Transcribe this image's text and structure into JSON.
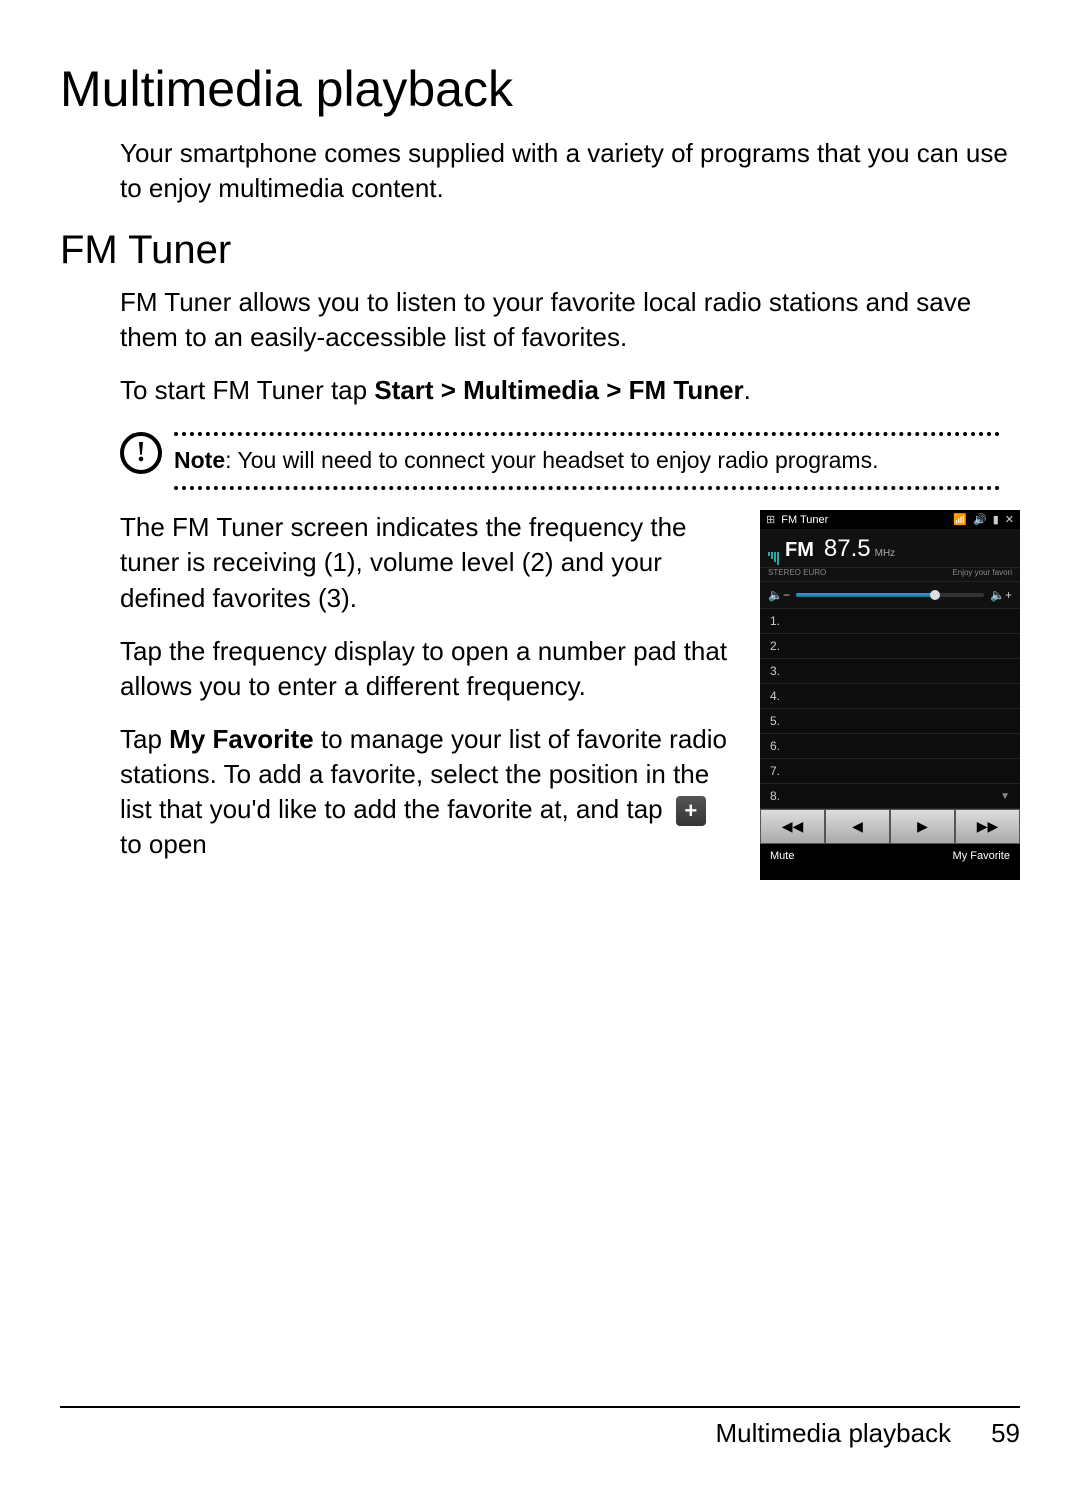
{
  "title": "Multimedia playback",
  "intro": "Your smartphone comes supplied with a variety of programs that you can use to enjoy multimedia content.",
  "section_heading": "FM Tuner",
  "fm_intro": "FM Tuner allows you to listen to your favorite local radio stations and save them to an easily-accessible list of favorites.",
  "nav_prefix": "To start FM Tuner tap ",
  "nav_path": "Start > Multimedia > FM Tuner",
  "nav_suffix": ".",
  "note_label": "Note",
  "note_body": ": You will need to connect your headset to enjoy radio programs.",
  "para_screen": "The FM Tuner screen indicates the frequency the tuner is receiving (1), volume level (2) and your defined favorites (3).",
  "para_tap_freq": "Tap the frequency display to open a number pad that allows you to enter a different frequency.",
  "fav_prefix": "Tap ",
  "fav_bold": "My Favorite",
  "fav_mid": " to manage your list of favorite radio stations. To add a favorite, select the position in the list that you'd like to add the favorite at, and tap ",
  "fav_suffix": " to open",
  "footer_title": "Multimedia playback",
  "page_number": "59",
  "phone": {
    "status_title": "FM Tuner",
    "band": "FM",
    "frequency": "87.5",
    "unit": "MHz",
    "sub_left": "STEREO EURO",
    "sub_right": "Enjoy your favori",
    "vol_minus": "−",
    "vol_plus": "+",
    "favorites": [
      "1.",
      "2.",
      "3.",
      "4.",
      "5.",
      "6.",
      "7.",
      "8."
    ],
    "ctrl_prevfast": "◀◀",
    "ctrl_prev": "◀",
    "ctrl_next": "▶",
    "ctrl_nextfast": "▶▶",
    "soft_left": "Mute",
    "soft_right": "My Favorite"
  }
}
